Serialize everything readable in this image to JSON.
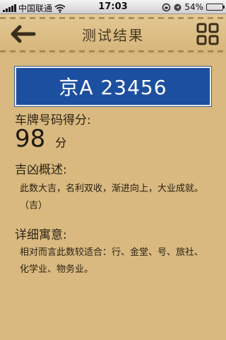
{
  "status_bar": {
    "carrier": "中国联通",
    "time": "17:03",
    "battery": "54%",
    "battery_level": 0.54
  },
  "nav": {
    "title": "测试结果",
    "back_icon": "back-arrow-icon",
    "menu_icon": "grid-icon"
  },
  "plate": {
    "text": "京A 23456",
    "background": "#1d4fa0"
  },
  "score": {
    "label": "车牌号码得分:",
    "value": "98",
    "unit": "分"
  },
  "summary": {
    "label": "吉凶概述:",
    "text": "此数大吉，名利双收，渐进向上，大业成就。（吉）"
  },
  "detail": {
    "label": "详细寓意:",
    "text": "相对而言此数较适合：行、金堂、号、旅社、化学业、物务业。"
  }
}
